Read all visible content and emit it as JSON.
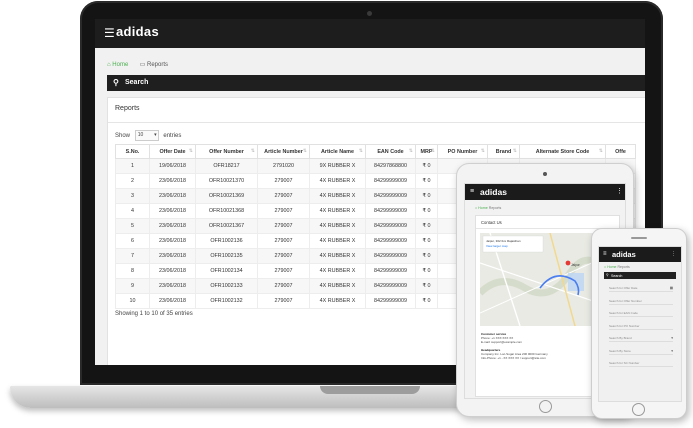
{
  "brand": {
    "logo_text": "adidas"
  },
  "breadcrumb": {
    "home": "Home",
    "reports": "Reports"
  },
  "search": {
    "label": "Search"
  },
  "reports": {
    "title": "Reports",
    "show_label": "Show",
    "entries_label": "entries",
    "page_size": "10",
    "footer": "Showing 1 to 10 of 35 entries",
    "columns": [
      "S.No.",
      "Offer Date",
      "Offer Number",
      "Article Number",
      "Article Name",
      "EAN Code",
      "MRP",
      "PO Number",
      "Brand",
      "Alternate Store Code",
      "Offe"
    ],
    "rows": [
      [
        "1",
        "19/06/2018",
        "OFR18217",
        "2791020",
        "9X RUBBER X",
        "84297868800",
        "₹ 0",
        "",
        "",
        "",
        ""
      ],
      [
        "2",
        "23/06/2018",
        "OFR10021370",
        "279007",
        "4X RUBBER X",
        "84299999009",
        "₹ 0",
        "",
        "",
        "",
        ""
      ],
      [
        "3",
        "23/06/2018",
        "OFR10021369",
        "279007",
        "4X RUBBER X",
        "84299999009",
        "₹ 0",
        "",
        "",
        "",
        ""
      ],
      [
        "4",
        "23/06/2018",
        "OFR10021368",
        "279007",
        "4X RUBBER X",
        "84299999009",
        "₹ 0",
        "",
        "",
        "",
        ""
      ],
      [
        "5",
        "23/06/2018",
        "OFR10021367",
        "279007",
        "4X RUBBER X",
        "84299999009",
        "₹ 0",
        "",
        "",
        "",
        ""
      ],
      [
        "6",
        "23/06/2018",
        "OFR1002136",
        "279007",
        "4X RUBBER X",
        "84299999009",
        "₹ 0",
        "",
        "",
        "",
        ""
      ],
      [
        "7",
        "23/06/2018",
        "OFR1002135",
        "279007",
        "4X RUBBER X",
        "84299999009",
        "₹ 0",
        "",
        "",
        "",
        ""
      ],
      [
        "8",
        "23/06/2018",
        "OFR1002134",
        "279007",
        "4X RUBBER X",
        "84299999009",
        "₹ 0",
        "",
        "",
        "",
        ""
      ],
      [
        "9",
        "23/06/2018",
        "OFR1002133",
        "279007",
        "4X RUBBER X",
        "84299999009",
        "₹ 0",
        "",
        "",
        "",
        ""
      ],
      [
        "10",
        "23/06/2018",
        "OFR1002132",
        "279007",
        "4X RUBBER X",
        "84299999009",
        "₹ 0",
        "",
        "",
        "",
        ""
      ]
    ]
  },
  "tablet": {
    "card_title": "Contact Us",
    "address_label": "Customer service",
    "address_lines": [
      "Phone: +1 XXX XXX XX",
      "E-mail: support@example.com"
    ],
    "hq_label": "Headquarters",
    "hq_lines": [
      "Company Inc. Loc-Sugar Area 200 0000 Germany",
      "Info-Phone: +1 - XX XXX XX / support@site.com"
    ],
    "map_marker_label": "Jaipur"
  },
  "phone": {
    "fields": [
      "Search for Offer Date",
      "Search for Offer Number",
      "Search for EAN Code",
      "Search for PO Number",
      "Search By Brand",
      "Search By Store",
      "Search for SC Number"
    ]
  },
  "colors": {
    "topbar": "#1d1d1d",
    "accent_green": "#4caf50"
  },
  "icons": [
    "menu-icon",
    "home-icon",
    "reports-icon",
    "search-icon",
    "sort-icon",
    "calendar-icon",
    "more-icon"
  ]
}
